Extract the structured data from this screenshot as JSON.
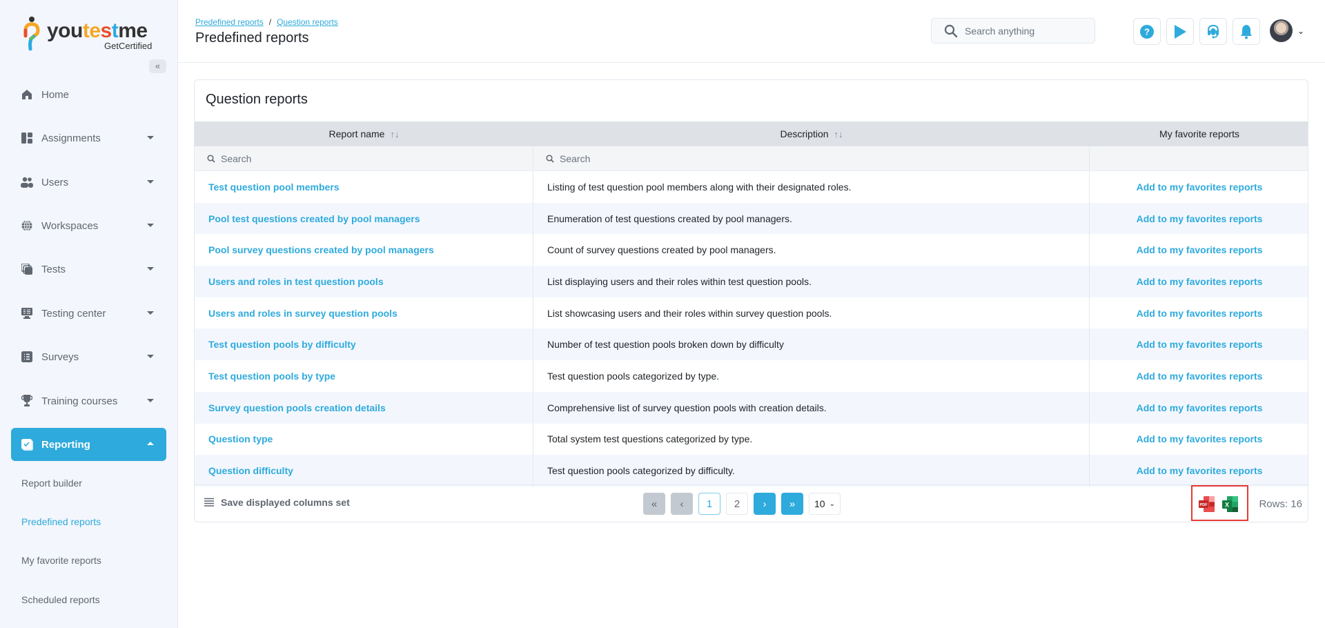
{
  "app": {
    "logo_text": [
      "you",
      "te",
      "s",
      "t",
      "me"
    ],
    "logo_sub": "GetCertified",
    "collapse_icon": "«"
  },
  "sidebar": {
    "items": [
      {
        "label": "Home",
        "icon": "home-icon",
        "has_caret": false
      },
      {
        "label": "Assignments",
        "icon": "assignments-icon",
        "has_caret": true
      },
      {
        "label": "Users",
        "icon": "users-icon",
        "has_caret": true
      },
      {
        "label": "Workspaces",
        "icon": "globe-icon",
        "has_caret": true
      },
      {
        "label": "Tests",
        "icon": "tests-icon",
        "has_caret": true
      },
      {
        "label": "Testing center",
        "icon": "monitor-icon",
        "has_caret": true
      },
      {
        "label": "Surveys",
        "icon": "list-icon",
        "has_caret": true
      },
      {
        "label": "Training courses",
        "icon": "trophy-icon",
        "has_caret": true
      },
      {
        "label": "Reporting",
        "icon": "reporting-icon",
        "has_caret": true,
        "active": true
      }
    ],
    "sub_items": [
      {
        "label": "Report builder"
      },
      {
        "label": "Predefined reports",
        "active": true
      },
      {
        "label": "My favorite reports"
      },
      {
        "label": "Scheduled reports"
      }
    ]
  },
  "header": {
    "breadcrumb": [
      "Predefined reports",
      "Question reports"
    ],
    "breadcrumb_sep": "/",
    "title": "Predefined reports",
    "search_placeholder": "Search anything",
    "icons": [
      "help-icon",
      "play-icon",
      "support-headset-icon",
      "bell-icon"
    ],
    "avatar_caret": "⌄"
  },
  "card": {
    "title": "Question reports",
    "columns": [
      {
        "label": "Report name",
        "sortable": true
      },
      {
        "label": "Description",
        "sortable": true
      },
      {
        "label": "My favorite reports",
        "sortable": false
      }
    ],
    "sort_glyph": "↑↓",
    "filter_placeholder": "Search",
    "rows": [
      {
        "name": "Test question pool members",
        "description": "Listing of test question pool members along with their designated roles.",
        "action": "Add to my favorites reports"
      },
      {
        "name": "Pool test questions created by pool managers",
        "description": "Enumeration of test questions created by pool managers.",
        "action": "Add to my favorites reports"
      },
      {
        "name": "Pool survey questions created by pool managers",
        "description": "Count of survey questions created by pool managers.",
        "action": "Add to my favorites reports"
      },
      {
        "name": "Users and roles in test question pools",
        "description": "List displaying users and their roles within test question pools.",
        "action": "Add to my favorites reports"
      },
      {
        "name": "Users and roles in survey question pools",
        "description": "List showcasing users and their roles within survey question pools.",
        "action": "Add to my favorites reports"
      },
      {
        "name": "Test question pools by difficulty",
        "description": "Number of test question pools broken down by difficulty",
        "action": "Add to my favorites reports"
      },
      {
        "name": "Test question pools by type",
        "description": "Test question pools categorized by type.",
        "action": "Add to my favorites reports"
      },
      {
        "name": "Survey question pools creation details",
        "description": "Comprehensive list of survey question pools with creation details.",
        "action": "Add to my favorites reports"
      },
      {
        "name": "Question type",
        "description": "Total system test questions categorized by type.",
        "action": "Add to my favorites reports"
      },
      {
        "name": "Question difficulty",
        "description": "Test question pools categorized by difficulty.",
        "action": "Add to my favorites reports"
      }
    ]
  },
  "footer": {
    "save_columns_label": "Save displayed columns set",
    "pager": {
      "first": "«",
      "prev": "‹",
      "pages": [
        "1",
        "2"
      ],
      "current_page": "1",
      "next": "›",
      "last": "»",
      "page_size": "10"
    },
    "export": {
      "pdf_label": "PDF",
      "excel_label": "X"
    },
    "rows_label": "Rows: 16"
  },
  "colors": {
    "accent": "#2eaadc",
    "sidebar_bg": "#f3f6fc",
    "highlight_border": "#e53935"
  }
}
